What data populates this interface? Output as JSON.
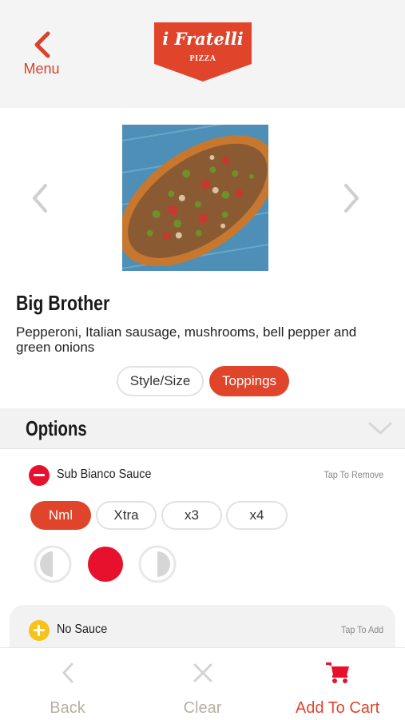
{
  "header": {
    "back_label": "Menu",
    "logo_line1": "i Fratelli",
    "logo_line2": "PIZZA"
  },
  "product": {
    "name": "Big Brother",
    "description": "Pepperoni, Italian sausage, mushrooms, bell pepper and green onions",
    "tabs": [
      {
        "label": "Style/Size",
        "active": false
      },
      {
        "label": "Toppings",
        "active": true
      }
    ]
  },
  "options": {
    "title": "Options",
    "selected_sauce": {
      "label": "Sub Bianco Sauce",
      "hint": "Tap To Remove",
      "amounts": [
        {
          "label": "Nml",
          "active": true
        },
        {
          "label": "Xtra",
          "active": false
        },
        {
          "label": "x3",
          "active": false
        },
        {
          "label": "x4",
          "active": false
        }
      ],
      "portions": [
        "left-half",
        "whole",
        "right-half"
      ],
      "selected_portion": "whole"
    },
    "other_sauce": {
      "label": "No Sauce",
      "hint": "Tap To Add"
    }
  },
  "bottom_bar": {
    "back_label": "Back",
    "clear_label": "Clear",
    "add_label": "Add To Cart"
  },
  "colors": {
    "accent": "#e0452c",
    "selected_red": "#e8112d",
    "add_yellow": "#f6c31c",
    "disabled_gray": "#b7b0a2"
  }
}
